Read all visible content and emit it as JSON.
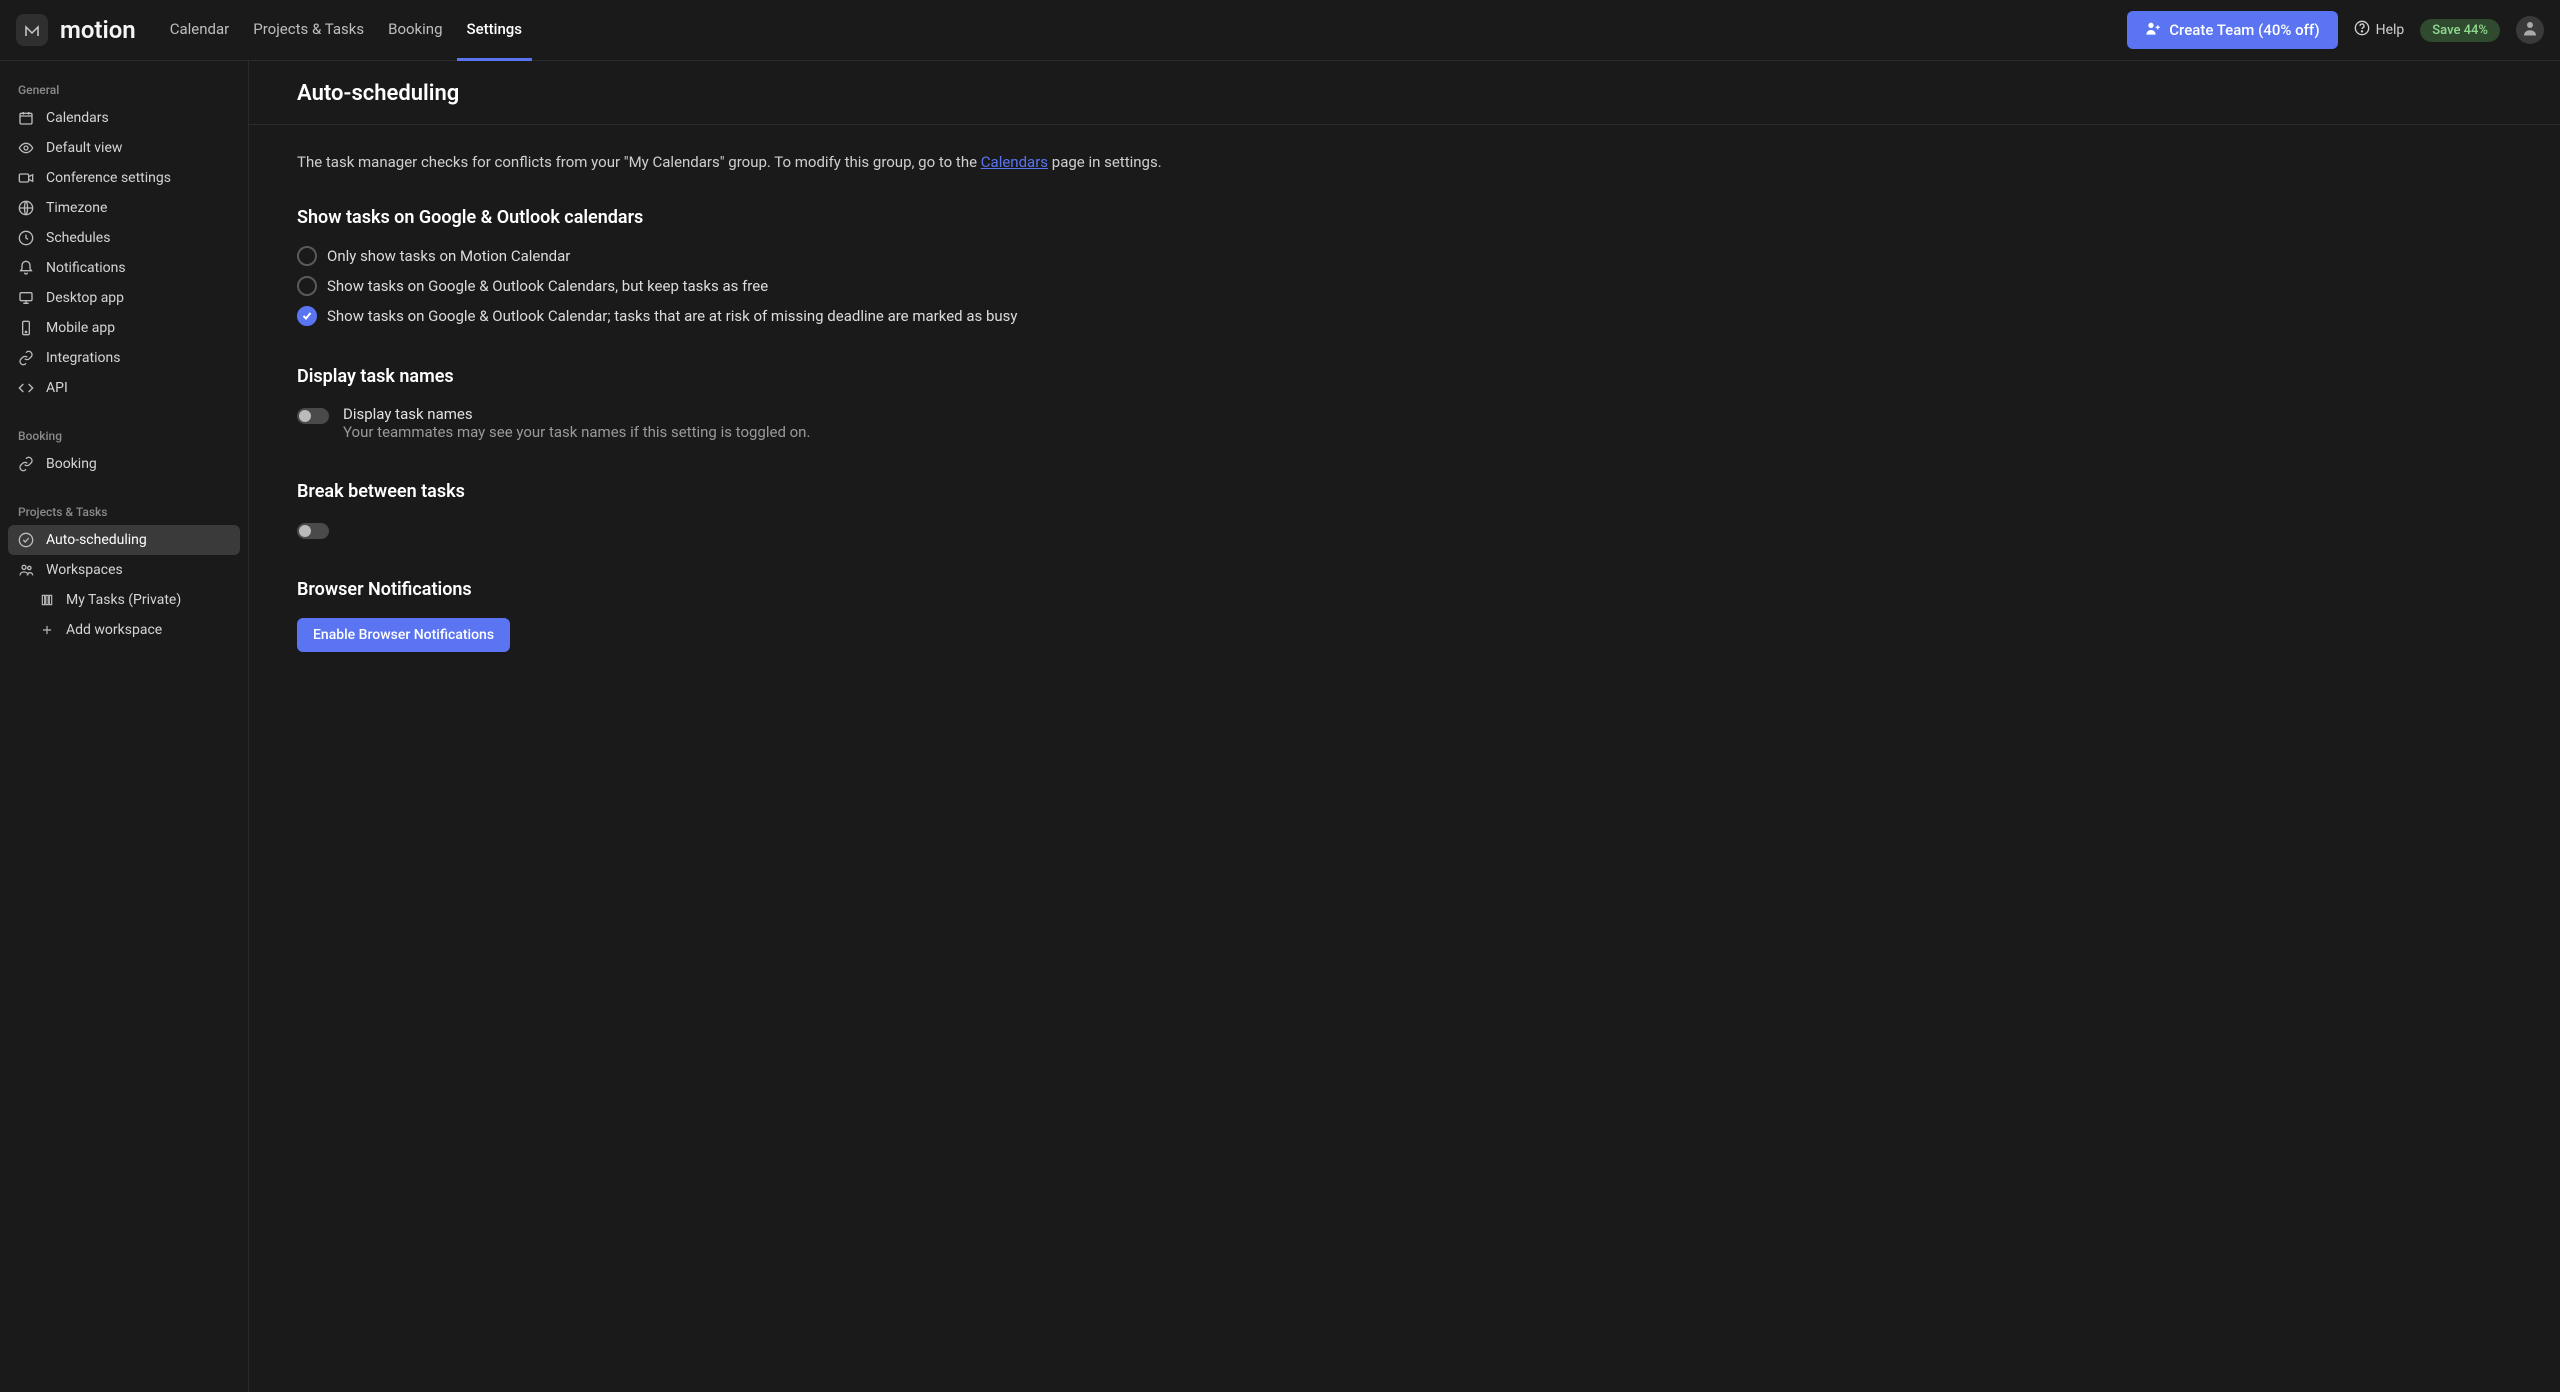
{
  "brand": "motion",
  "topnav": {
    "items": [
      "Calendar",
      "Projects & Tasks",
      "Booking",
      "Settings"
    ],
    "active_index": 3
  },
  "topbar": {
    "create_team_label": "Create Team (40% off)",
    "help_label": "Help",
    "save_badge": "Save 44%"
  },
  "sidebar": {
    "sections": [
      {
        "title": "General",
        "items": [
          {
            "label": "Calendars",
            "icon": "calendar-icon"
          },
          {
            "label": "Default view",
            "icon": "eye-icon"
          },
          {
            "label": "Conference settings",
            "icon": "video-icon"
          },
          {
            "label": "Timezone",
            "icon": "globe-icon"
          },
          {
            "label": "Schedules",
            "icon": "clock-icon"
          },
          {
            "label": "Notifications",
            "icon": "bell-icon"
          },
          {
            "label": "Desktop app",
            "icon": "desktop-icon"
          },
          {
            "label": "Mobile app",
            "icon": "mobile-icon"
          },
          {
            "label": "Integrations",
            "icon": "link-icon"
          },
          {
            "label": "API",
            "icon": "code-icon"
          }
        ]
      },
      {
        "title": "Booking",
        "items": [
          {
            "label": "Booking",
            "icon": "link-icon"
          }
        ]
      },
      {
        "title": "Projects & Tasks",
        "items": [
          {
            "label": "Auto-scheduling",
            "icon": "check-circle-icon",
            "active": true
          },
          {
            "label": "Workspaces",
            "icon": "users-icon"
          }
        ],
        "sub_items": [
          {
            "label": "My Tasks (Private)",
            "icon": "columns-icon"
          },
          {
            "label": "Add workspace",
            "icon": "plus-icon"
          }
        ]
      }
    ]
  },
  "main": {
    "title": "Auto-scheduling",
    "description_parts": {
      "before_link": "The task manager checks for conflicts from your \"My Calendars\" group. To modify this group, go to the ",
      "link": "Calendars",
      "after_link": " page in settings."
    },
    "show_tasks": {
      "heading": "Show tasks on Google & Outlook calendars",
      "options": [
        "Only show tasks on Motion Calendar",
        "Show tasks on Google & Outlook Calendars, but keep tasks as free",
        "Show tasks on Google & Outlook Calendar; tasks that are at risk of missing deadline are marked as busy"
      ],
      "selected_index": 2
    },
    "display_names": {
      "heading": "Display task names",
      "toggle_label": "Display task names",
      "toggle_help": "Your teammates may see your task names if this setting is toggled on.",
      "enabled": false
    },
    "break_between": {
      "heading": "Break between tasks",
      "enabled": false
    },
    "browser_notifications": {
      "heading": "Browser Notifications",
      "button": "Enable Browser Notifications"
    }
  }
}
